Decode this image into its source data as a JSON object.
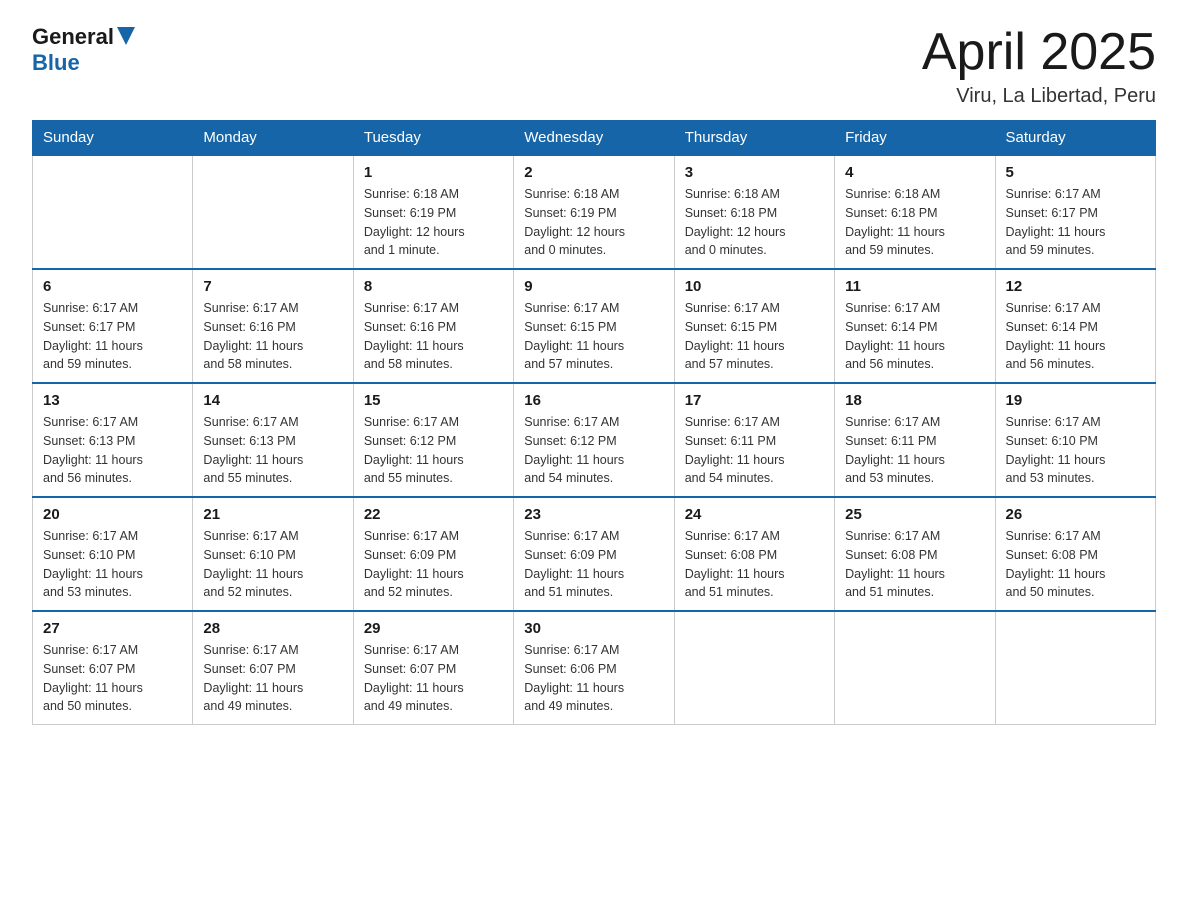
{
  "header": {
    "logo_general": "General",
    "logo_blue": "Blue",
    "title": "April 2025",
    "subtitle": "Viru, La Libertad, Peru"
  },
  "weekdays": [
    "Sunday",
    "Monday",
    "Tuesday",
    "Wednesday",
    "Thursday",
    "Friday",
    "Saturday"
  ],
  "weeks": [
    [
      {
        "day": "",
        "info": ""
      },
      {
        "day": "",
        "info": ""
      },
      {
        "day": "1",
        "info": "Sunrise: 6:18 AM\nSunset: 6:19 PM\nDaylight: 12 hours\nand 1 minute."
      },
      {
        "day": "2",
        "info": "Sunrise: 6:18 AM\nSunset: 6:19 PM\nDaylight: 12 hours\nand 0 minutes."
      },
      {
        "day": "3",
        "info": "Sunrise: 6:18 AM\nSunset: 6:18 PM\nDaylight: 12 hours\nand 0 minutes."
      },
      {
        "day": "4",
        "info": "Sunrise: 6:18 AM\nSunset: 6:18 PM\nDaylight: 11 hours\nand 59 minutes."
      },
      {
        "day": "5",
        "info": "Sunrise: 6:17 AM\nSunset: 6:17 PM\nDaylight: 11 hours\nand 59 minutes."
      }
    ],
    [
      {
        "day": "6",
        "info": "Sunrise: 6:17 AM\nSunset: 6:17 PM\nDaylight: 11 hours\nand 59 minutes."
      },
      {
        "day": "7",
        "info": "Sunrise: 6:17 AM\nSunset: 6:16 PM\nDaylight: 11 hours\nand 58 minutes."
      },
      {
        "day": "8",
        "info": "Sunrise: 6:17 AM\nSunset: 6:16 PM\nDaylight: 11 hours\nand 58 minutes."
      },
      {
        "day": "9",
        "info": "Sunrise: 6:17 AM\nSunset: 6:15 PM\nDaylight: 11 hours\nand 57 minutes."
      },
      {
        "day": "10",
        "info": "Sunrise: 6:17 AM\nSunset: 6:15 PM\nDaylight: 11 hours\nand 57 minutes."
      },
      {
        "day": "11",
        "info": "Sunrise: 6:17 AM\nSunset: 6:14 PM\nDaylight: 11 hours\nand 56 minutes."
      },
      {
        "day": "12",
        "info": "Sunrise: 6:17 AM\nSunset: 6:14 PM\nDaylight: 11 hours\nand 56 minutes."
      }
    ],
    [
      {
        "day": "13",
        "info": "Sunrise: 6:17 AM\nSunset: 6:13 PM\nDaylight: 11 hours\nand 56 minutes."
      },
      {
        "day": "14",
        "info": "Sunrise: 6:17 AM\nSunset: 6:13 PM\nDaylight: 11 hours\nand 55 minutes."
      },
      {
        "day": "15",
        "info": "Sunrise: 6:17 AM\nSunset: 6:12 PM\nDaylight: 11 hours\nand 55 minutes."
      },
      {
        "day": "16",
        "info": "Sunrise: 6:17 AM\nSunset: 6:12 PM\nDaylight: 11 hours\nand 54 minutes."
      },
      {
        "day": "17",
        "info": "Sunrise: 6:17 AM\nSunset: 6:11 PM\nDaylight: 11 hours\nand 54 minutes."
      },
      {
        "day": "18",
        "info": "Sunrise: 6:17 AM\nSunset: 6:11 PM\nDaylight: 11 hours\nand 53 minutes."
      },
      {
        "day": "19",
        "info": "Sunrise: 6:17 AM\nSunset: 6:10 PM\nDaylight: 11 hours\nand 53 minutes."
      }
    ],
    [
      {
        "day": "20",
        "info": "Sunrise: 6:17 AM\nSunset: 6:10 PM\nDaylight: 11 hours\nand 53 minutes."
      },
      {
        "day": "21",
        "info": "Sunrise: 6:17 AM\nSunset: 6:10 PM\nDaylight: 11 hours\nand 52 minutes."
      },
      {
        "day": "22",
        "info": "Sunrise: 6:17 AM\nSunset: 6:09 PM\nDaylight: 11 hours\nand 52 minutes."
      },
      {
        "day": "23",
        "info": "Sunrise: 6:17 AM\nSunset: 6:09 PM\nDaylight: 11 hours\nand 51 minutes."
      },
      {
        "day": "24",
        "info": "Sunrise: 6:17 AM\nSunset: 6:08 PM\nDaylight: 11 hours\nand 51 minutes."
      },
      {
        "day": "25",
        "info": "Sunrise: 6:17 AM\nSunset: 6:08 PM\nDaylight: 11 hours\nand 51 minutes."
      },
      {
        "day": "26",
        "info": "Sunrise: 6:17 AM\nSunset: 6:08 PM\nDaylight: 11 hours\nand 50 minutes."
      }
    ],
    [
      {
        "day": "27",
        "info": "Sunrise: 6:17 AM\nSunset: 6:07 PM\nDaylight: 11 hours\nand 50 minutes."
      },
      {
        "day": "28",
        "info": "Sunrise: 6:17 AM\nSunset: 6:07 PM\nDaylight: 11 hours\nand 49 minutes."
      },
      {
        "day": "29",
        "info": "Sunrise: 6:17 AM\nSunset: 6:07 PM\nDaylight: 11 hours\nand 49 minutes."
      },
      {
        "day": "30",
        "info": "Sunrise: 6:17 AM\nSunset: 6:06 PM\nDaylight: 11 hours\nand 49 minutes."
      },
      {
        "day": "",
        "info": ""
      },
      {
        "day": "",
        "info": ""
      },
      {
        "day": "",
        "info": ""
      }
    ]
  ]
}
